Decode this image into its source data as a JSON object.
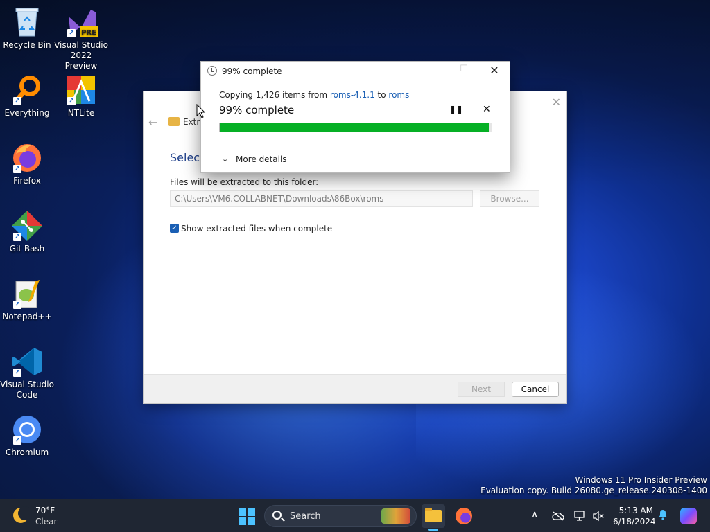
{
  "desktop": {
    "icons": [
      {
        "label": "Recycle Bin",
        "icon": "recycle-bin-icon"
      },
      {
        "label": "Visual Studio 2022 Preview",
        "icon": "visual-studio-icon",
        "badge": "PRE"
      },
      {
        "label": "Everything",
        "icon": "everything-search-icon"
      },
      {
        "label": "NTLite",
        "icon": "ntlite-icon"
      },
      {
        "label": "Firefox",
        "icon": "firefox-icon"
      },
      {
        "label": "Git Bash",
        "icon": "git-bash-icon"
      },
      {
        "label": "Notepad++",
        "icon": "notepad-plus-plus-icon"
      },
      {
        "label": "Visual Studio Code",
        "icon": "vscode-icon"
      },
      {
        "label": "Chromium",
        "icon": "chromium-icon"
      }
    ],
    "shortcut_arrow": "↗"
  },
  "extract_dialog": {
    "title": "Extra",
    "heading": "Select",
    "folder_label": "Files will be extracted to this folder:",
    "path_value": "C:\\Users\\VM6.COLLABNET\\Downloads\\86Box\\roms",
    "browse_label": "Browse...",
    "show_files_label": "Show extracted files when complete",
    "next_label": "Next",
    "cancel_label": "Cancel",
    "close_glyph": "✕",
    "back_glyph": "←"
  },
  "copy_dialog": {
    "title": "99% complete",
    "copying_prefix": "Copying 1,426 items from ",
    "source": "roms-4.1.1",
    "to_word": " to ",
    "destination": "roms",
    "status": "99% complete",
    "progress_percent": 99,
    "progress_color": "#06b025",
    "more_details": "More details",
    "minimize_glyph": "—",
    "maximize_glyph": "☐",
    "close_glyph": "✕",
    "pause_glyph": "❚❚",
    "stop_glyph": "✕",
    "chevron_glyph": "⌄"
  },
  "watermark": {
    "line1": "Windows 11 Pro Insider Preview",
    "line2": "Evaluation copy. Build 26080.ge_release.240308-1400"
  },
  "taskbar": {
    "weather_temp": "70°F",
    "weather_cond": "Clear",
    "search_label": "Search",
    "time": "5:13 AM",
    "date": "6/18/2024",
    "tray": {
      "chevron": "∧"
    },
    "accent": "#4cc2ff"
  }
}
